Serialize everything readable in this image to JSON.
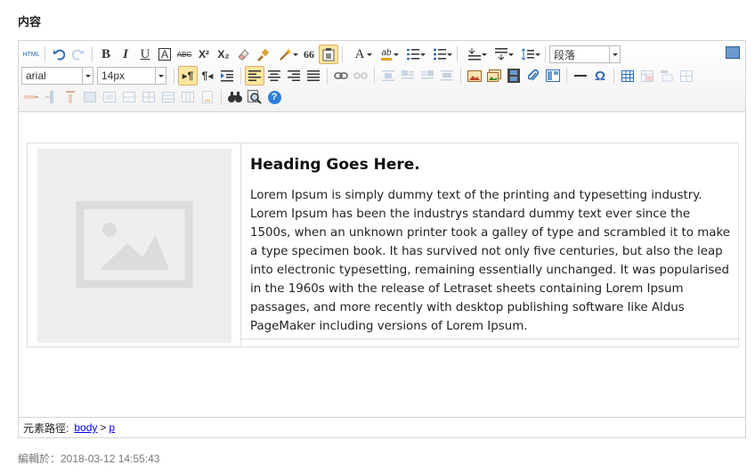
{
  "field_label": "内容",
  "toolbar": {
    "font_family": "arial",
    "font_size": "14px",
    "paragraph_format": "段落",
    "html_label": "HTML",
    "bold": "B",
    "italic": "I",
    "underline": "U",
    "border_char": "A",
    "strike_label": "ABC",
    "superscript": "X²",
    "subscript": "X₂",
    "quote_char": "66",
    "font_color_char": "A",
    "highlight_label": "ab",
    "omega": "Ω",
    "help": "?"
  },
  "editor": {
    "heading": "Heading Goes Here.",
    "body": "Lorem Ipsum is simply dummy text of the printing and typesetting industry. Lorem Ipsum has been the industrys standard dummy text ever since the 1500s, when an unknown printer took a galley of type and scrambled it to make a type specimen book. It has survived not only five centuries, but also the leap into electronic typesetting, remaining essentially unchanged. It was popularised in the 1960s with the release of Letraset sheets containing Lorem Ipsum passages, and more recently with desktop publishing software like Aldus PageMaker including versions of Lorem Ipsum."
  },
  "statusbar": {
    "path_label": "元素路徑:",
    "path": [
      {
        "label": "body"
      },
      {
        "label": "p"
      }
    ],
    "path_separator": ">"
  },
  "edited_at": "編輯於：2018-03-12 14:55:43",
  "colors": {
    "accent_active": "#ffe69f",
    "link": "#0000ee",
    "icon_blue": "#2d6bb5",
    "placeholder_bg": "#eeeeee"
  }
}
